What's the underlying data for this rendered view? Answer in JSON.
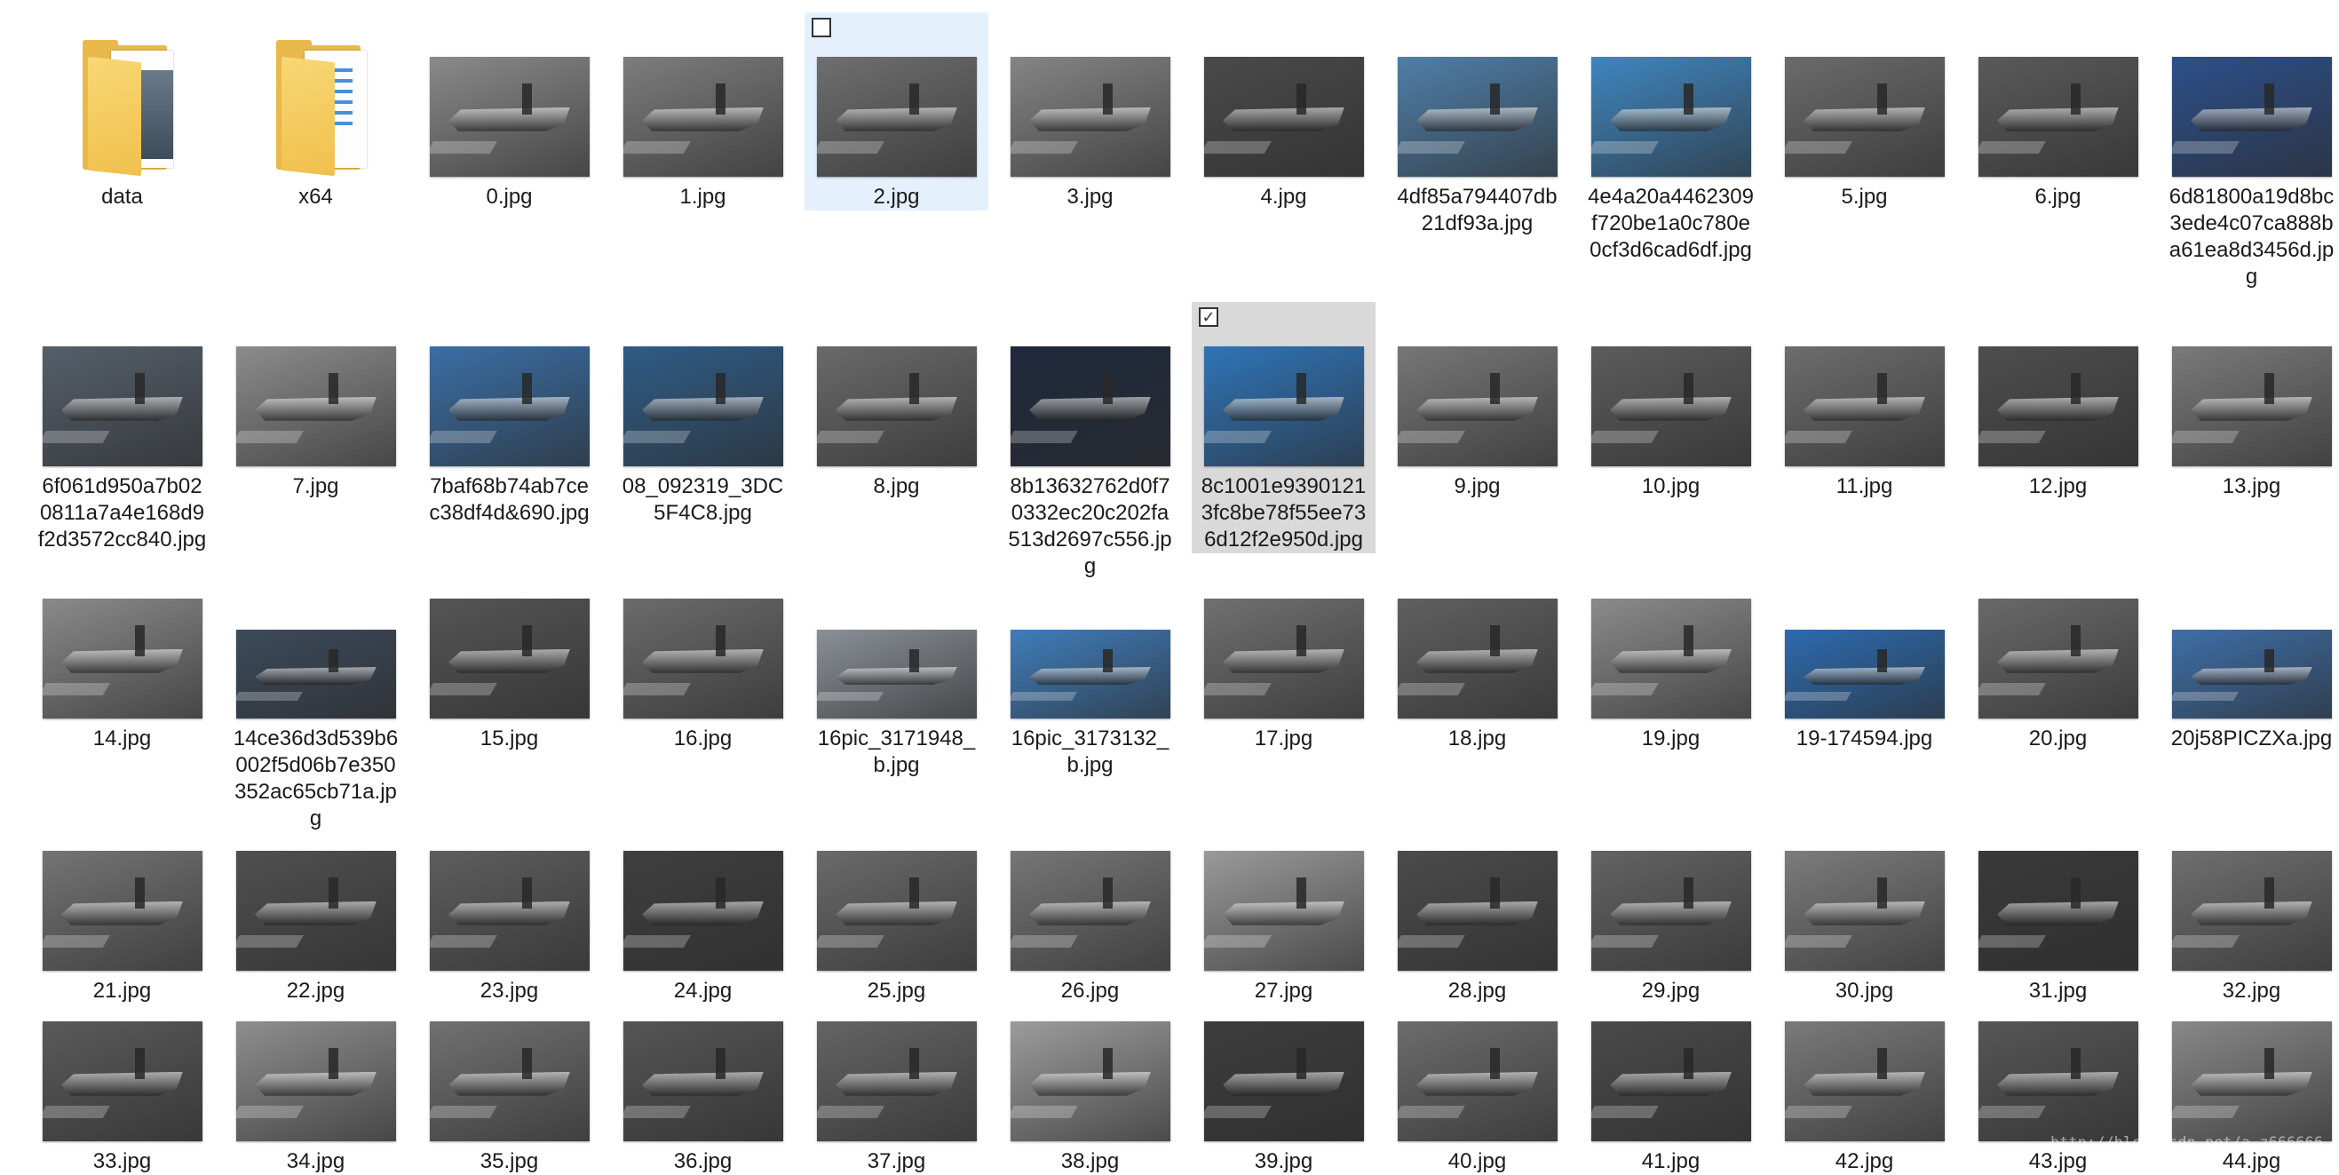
{
  "window": {
    "background": "#ffffff",
    "selection_color": "#e4f1fd",
    "checked_color": "#d9d9d9"
  },
  "items": [
    {
      "name": "data",
      "type": "folder"
    },
    {
      "name": "x64",
      "type": "folder"
    },
    {
      "name": "0.jpg",
      "type": "image",
      "tone": "#8a8a8a"
    },
    {
      "name": "1.jpg",
      "type": "image",
      "tone": "#7d7d7d"
    },
    {
      "name": "2.jpg",
      "type": "image",
      "tone": "#6f6f6f",
      "state": "selected"
    },
    {
      "name": "3.jpg",
      "type": "image",
      "tone": "#858585"
    },
    {
      "name": "4.jpg",
      "type": "image",
      "tone": "#4a4a4a"
    },
    {
      "name": "4df85a794407db21df93a.jpg",
      "type": "image",
      "tone": "#4f7fa8"
    },
    {
      "name": "4e4a20a4462309f720be1a0c780e0cf3d6cad6df.jpg",
      "type": "image",
      "tone": "#3f86bf"
    },
    {
      "name": "5.jpg",
      "type": "image",
      "tone": "#6b6b6b"
    },
    {
      "name": "6.jpg",
      "type": "image",
      "tone": "#5a5a5a"
    },
    {
      "name": "6d81800a19d8bc3ede4c07ca888ba61ea8d3456d.jpg",
      "type": "image",
      "tone": "#2d4f8a"
    },
    {
      "name": "6f061d950a7b020811a7a4e168d9f2d3572cc840.jpg",
      "type": "image",
      "tone": "#555f6a"
    },
    {
      "name": "7.jpg",
      "type": "image",
      "tone": "#8c8c8c"
    },
    {
      "name": "7baf68b74ab7cec38df4d&690.jpg",
      "type": "image",
      "tone": "#3a6ea5"
    },
    {
      "name": "08_092319_3DC5F4C8.jpg",
      "type": "image",
      "tone": "#2f5c86"
    },
    {
      "name": "8.jpg",
      "type": "image",
      "tone": "#6a6a6a"
    },
    {
      "name": "8b13632762d0f70332ec20c202fa513d2697c556.jpg",
      "type": "image",
      "tone": "#1f2a3d"
    },
    {
      "name": "8c1001e93901213fc8be78f55ee736d12f2e950d.jpg",
      "type": "image",
      "tone": "#2f74b8",
      "state": "checked"
    },
    {
      "name": "9.jpg",
      "type": "image",
      "tone": "#777777"
    },
    {
      "name": "10.jpg",
      "type": "image",
      "tone": "#5c5c5c"
    },
    {
      "name": "11.jpg",
      "type": "image",
      "tone": "#6d6d6d"
    },
    {
      "name": "12.jpg",
      "type": "image",
      "tone": "#4e4e4e"
    },
    {
      "name": "13.jpg",
      "type": "image",
      "tone": "#7a7a7a"
    },
    {
      "name": "14.jpg",
      "type": "image",
      "tone": "#8a8a8a"
    },
    {
      "name": "14ce36d3d539b6002f5d06b7e350352ac65cb71a.jpg",
      "type": "image",
      "tone": "#3c4a5a",
      "short": true
    },
    {
      "name": "15.jpg",
      "type": "image",
      "tone": "#555555"
    },
    {
      "name": "16.jpg",
      "type": "image",
      "tone": "#6b6b6b"
    },
    {
      "name": "16pic_3171948_b.jpg",
      "type": "image",
      "tone": "#8a9098",
      "short": true
    },
    {
      "name": "16pic_3173132_b.jpg",
      "type": "image",
      "tone": "#3f7dbb",
      "short": true
    },
    {
      "name": "17.jpg",
      "type": "image",
      "tone": "#707070"
    },
    {
      "name": "18.jpg",
      "type": "image",
      "tone": "#606060"
    },
    {
      "name": "19.jpg",
      "type": "image",
      "tone": "#8b8b8b"
    },
    {
      "name": "19-174594.jpg",
      "type": "image",
      "tone": "#2d6bb0",
      "short": true
    },
    {
      "name": "20.jpg",
      "type": "image",
      "tone": "#696969"
    },
    {
      "name": "20j58PICZXa.jpg",
      "type": "image",
      "tone": "#3e6fa8",
      "short": true
    },
    {
      "name": "21.jpg",
      "type": "image",
      "tone": "#747474"
    },
    {
      "name": "22.jpg",
      "type": "image",
      "tone": "#505050"
    },
    {
      "name": "23.jpg",
      "type": "image",
      "tone": "#5e5e5e"
    },
    {
      "name": "24.jpg",
      "type": "image",
      "tone": "#3f3f3f"
    },
    {
      "name": "25.jpg",
      "type": "image",
      "tone": "#6a6a6a"
    },
    {
      "name": "26.jpg",
      "type": "image",
      "tone": "#767676"
    },
    {
      "name": "27.jpg",
      "type": "image",
      "tone": "#9a9a9a"
    },
    {
      "name": "28.jpg",
      "type": "image",
      "tone": "#4b4b4b"
    },
    {
      "name": "29.jpg",
      "type": "image",
      "tone": "#636363"
    },
    {
      "name": "30.jpg",
      "type": "image",
      "tone": "#7c7c7c"
    },
    {
      "name": "31.jpg",
      "type": "image",
      "tone": "#3a3a3a"
    },
    {
      "name": "32.jpg",
      "type": "image",
      "tone": "#6f6f6f"
    },
    {
      "name": "33.jpg",
      "type": "image",
      "tone": "#5a5a5a"
    },
    {
      "name": "34.jpg",
      "type": "image",
      "tone": "#8e8e8e"
    },
    {
      "name": "35.jpg",
      "type": "image",
      "tone": "#717171"
    },
    {
      "name": "36.jpg",
      "type": "image",
      "tone": "#555555"
    },
    {
      "name": "37.jpg",
      "type": "image",
      "tone": "#646464"
    },
    {
      "name": "38.jpg",
      "type": "image",
      "tone": "#9c9c9c"
    },
    {
      "name": "39.jpg",
      "type": "image",
      "tone": "#3d3d3d"
    },
    {
      "name": "40.jpg",
      "type": "image",
      "tone": "#6c6c6c"
    },
    {
      "name": "41.jpg",
      "type": "image",
      "tone": "#4a4a4a"
    },
    {
      "name": "42.jpg",
      "type": "image",
      "tone": "#7a7a7a"
    },
    {
      "name": "43.jpg",
      "type": "image",
      "tone": "#565656"
    },
    {
      "name": "44.jpg",
      "type": "image",
      "tone": "#888888"
    }
  ],
  "watermark": "http://blog.csdn.net/a_z666666"
}
